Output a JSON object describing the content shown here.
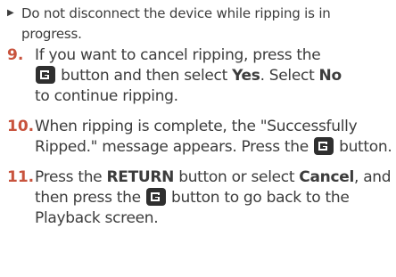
{
  "note": {
    "icon": "triangle-bullet-icon",
    "text": "Do not disconnect the device while ripping is in progress."
  },
  "steps": [
    {
      "number": "9.",
      "part1": "If you want to cancel ripping, press the",
      "icon": "enter-button-icon",
      "part2": "button and then select",
      "yes": "Yes",
      "part3": ". Select",
      "no": "No",
      "part4": "to continue ripping."
    },
    {
      "number": "10.",
      "part1": "When ripping is complete, the \"Successfully Ripped.\" message appears. Press the",
      "icon": "enter-button-icon",
      "part2": "button."
    },
    {
      "number": "11.",
      "part1": "Press the",
      "return": "RETURN",
      "part2": "button or select",
      "cancel": "Cancel",
      "part3": ", and then press the",
      "icon": "enter-button-icon",
      "part4": "button to go back to the Playback screen."
    }
  ],
  "colors": {
    "step_number": "#c8533d",
    "text": "#3c3c3c",
    "icon_bg": "#2f2f2f"
  }
}
